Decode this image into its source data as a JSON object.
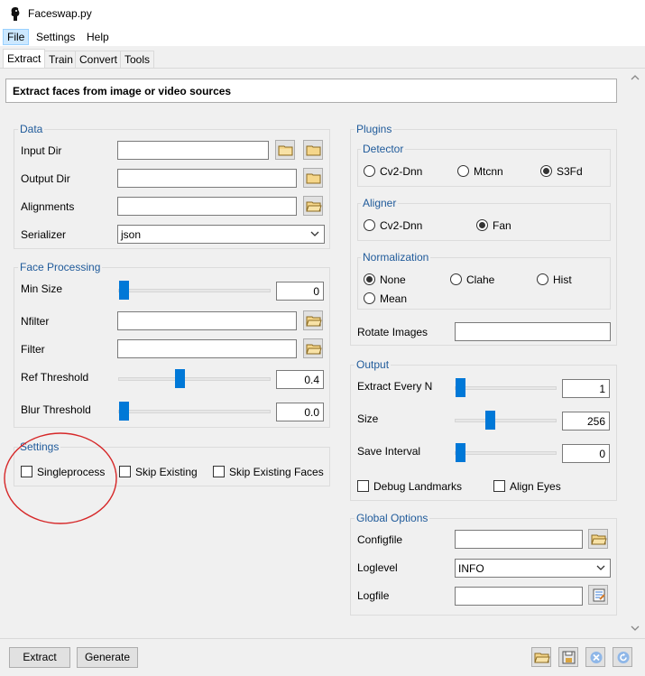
{
  "window": {
    "title": "Faceswap.py"
  },
  "menu": {
    "items": [
      "File",
      "Settings",
      "Help"
    ]
  },
  "tabs": [
    "Extract",
    "Train",
    "Convert",
    "Tools"
  ],
  "info": {
    "text": "Extract faces from image or video sources"
  },
  "data_group": {
    "title": "Data",
    "input_dir": {
      "label": "Input Dir",
      "value": ""
    },
    "output_dir": {
      "label": "Output Dir",
      "value": ""
    },
    "alignments": {
      "label": "Alignments",
      "value": ""
    },
    "serializer": {
      "label": "Serializer",
      "value": "json"
    }
  },
  "face_processing": {
    "title": "Face Processing",
    "min_size": {
      "label": "Min Size",
      "value": "0",
      "level": 0
    },
    "nfilter": {
      "label": "Nfilter",
      "value": ""
    },
    "filter": {
      "label": "Filter",
      "value": ""
    },
    "ref_threshold": {
      "label": "Ref Threshold",
      "value": "0.4",
      "level": 0.4
    },
    "blur_threshold": {
      "label": "Blur Threshold",
      "value": "0.0",
      "level": 0
    }
  },
  "settings_group": {
    "title": "Settings",
    "singleprocess": {
      "label": "Singleprocess",
      "checked": false
    },
    "skip_existing": {
      "label": "Skip Existing",
      "checked": false
    },
    "skip_existing_faces": {
      "label": "Skip Existing Faces",
      "checked": false
    }
  },
  "plugins": {
    "title": "Plugins",
    "detector": {
      "title": "Detector",
      "options": [
        "Cv2-Dnn",
        "Mtcnn",
        "S3Fd"
      ],
      "selected": "S3Fd"
    },
    "aligner": {
      "title": "Aligner",
      "options": [
        "Cv2-Dnn",
        "Fan"
      ],
      "selected": "Fan"
    },
    "normalization": {
      "title": "Normalization",
      "options": [
        "None",
        "Clahe",
        "Hist",
        "Mean"
      ],
      "selected": "None"
    },
    "rotate_images": {
      "label": "Rotate Images",
      "value": ""
    }
  },
  "output": {
    "title": "Output",
    "extract_every_n": {
      "label": "Extract Every N",
      "value": "1",
      "level": 0
    },
    "size": {
      "label": "Size",
      "value": "256",
      "level": 0.35
    },
    "save_interval": {
      "label": "Save Interval",
      "value": "0",
      "level": 0
    },
    "debug_landmarks": {
      "label": "Debug Landmarks",
      "checked": false
    },
    "align_eyes": {
      "label": "Align Eyes",
      "checked": false
    }
  },
  "global_options": {
    "title": "Global Options",
    "configfile": {
      "label": "Configfile",
      "value": ""
    },
    "loglevel": {
      "label": "Loglevel",
      "value": "INFO"
    },
    "logfile": {
      "label": "Logfile",
      "value": ""
    }
  },
  "bottom": {
    "extract_button": "Extract",
    "generate_button": "Generate"
  },
  "colors": {
    "accent": "#0078d7",
    "group_title": "#1f5a9a",
    "annotation": "#d62728"
  },
  "icons": [
    "folder-icon",
    "save-icon",
    "clear-icon",
    "reload-icon",
    "settings-file-icon"
  ]
}
